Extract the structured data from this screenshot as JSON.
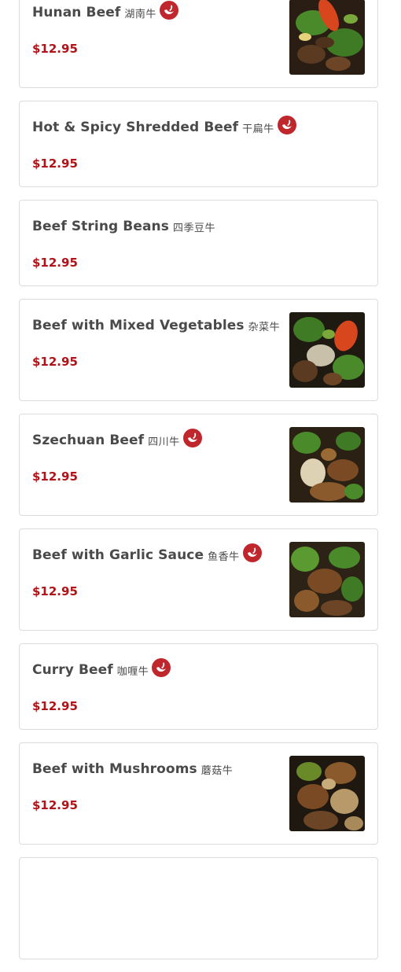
{
  "colors": {
    "price": "#b11217",
    "spicy_icon": "#c0272d",
    "text": "#4a4a4a",
    "border": "#dcdcdc"
  },
  "menu": {
    "items": [
      {
        "name": "Hunan Beef",
        "cn": "湖南牛",
        "price": "$12.95",
        "spicy": true,
        "photo": "beef-vegetables-photo"
      },
      {
        "name": "Hot & Spicy Shredded Beef",
        "cn": "干扁牛",
        "price": "$12.95",
        "spicy": true,
        "photo": null
      },
      {
        "name": "Beef String Beans",
        "cn": "四季豆牛",
        "price": "$12.95",
        "spicy": false,
        "photo": null
      },
      {
        "name": "Beef with Mixed Vegetables",
        "cn": "杂菜牛",
        "price": "$12.95",
        "spicy": false,
        "photo": "beef-vegetables-photo"
      },
      {
        "name": "Szechuan Beef",
        "cn": "四川牛",
        "price": "$12.95",
        "spicy": true,
        "photo": "beef-broccoli-photo"
      },
      {
        "name": "Beef with Garlic Sauce",
        "cn": "鱼香牛",
        "price": "$12.95",
        "spicy": true,
        "photo": "beef-broccoli-photo"
      },
      {
        "name": "Curry Beef",
        "cn": "咖喱牛",
        "price": "$12.95",
        "spicy": true,
        "photo": null
      },
      {
        "name": "Beef with Mushrooms",
        "cn": "蘑菇牛",
        "price": "$12.95",
        "spicy": false,
        "photo": "beef-mushroom-photo"
      }
    ]
  }
}
